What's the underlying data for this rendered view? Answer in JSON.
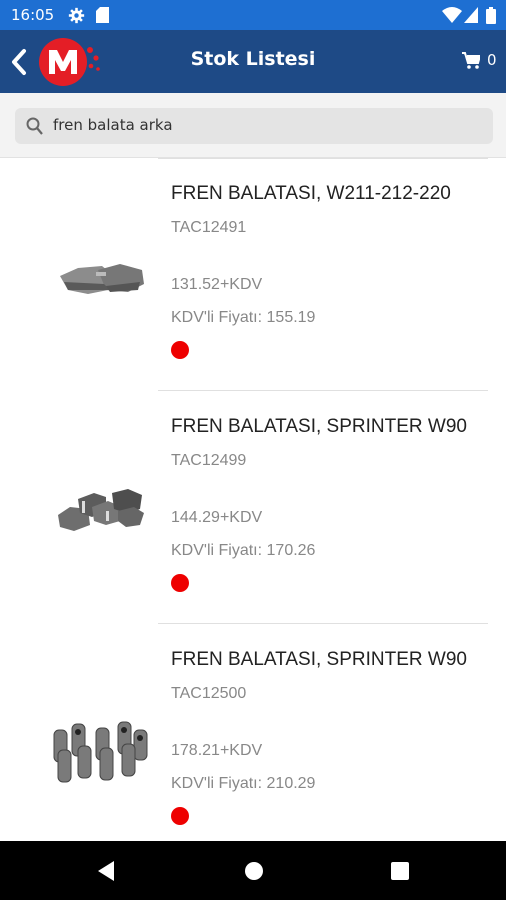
{
  "status_bar": {
    "time": "16:05",
    "icons": [
      "gear-icon",
      "sd-card-icon",
      "wifi-icon",
      "signal-icon",
      "battery-icon"
    ]
  },
  "app_bar": {
    "title": "Stok Listesi",
    "cart_count": "0",
    "icons": [
      "back-arrow-icon",
      "brand-logo",
      "cart-icon"
    ]
  },
  "search": {
    "value": "fren balata arka",
    "icon": "search-icon"
  },
  "products": [
    {
      "name": "FREN BALATASI, W211-212-220",
      "code": "TAC12491",
      "price": "131.52+KDV",
      "kdv_price": "KDV'li Fiyatı: 155.19",
      "stock_color": "#ee0000"
    },
    {
      "name": "FREN BALATASI, SPRINTER W90",
      "code": "TAC12499",
      "price": "144.29+KDV",
      "kdv_price": "KDV'li Fiyatı: 170.26",
      "stock_color": "#ee0000"
    },
    {
      "name": "FREN BALATASI, SPRINTER W90",
      "code": "TAC12500",
      "price": "178.21+KDV",
      "kdv_price": "KDV'li Fiyatı: 210.29",
      "stock_color": "#ee0000"
    }
  ],
  "nav_bar": {
    "icons": [
      "back-triangle-icon",
      "home-circle-icon",
      "recents-square-icon"
    ]
  },
  "colors": {
    "status_bar": "#1e6fd2",
    "app_bar": "#1e4a86",
    "logo_red": "#e41e26",
    "stock_indicator": "#ee0000"
  }
}
